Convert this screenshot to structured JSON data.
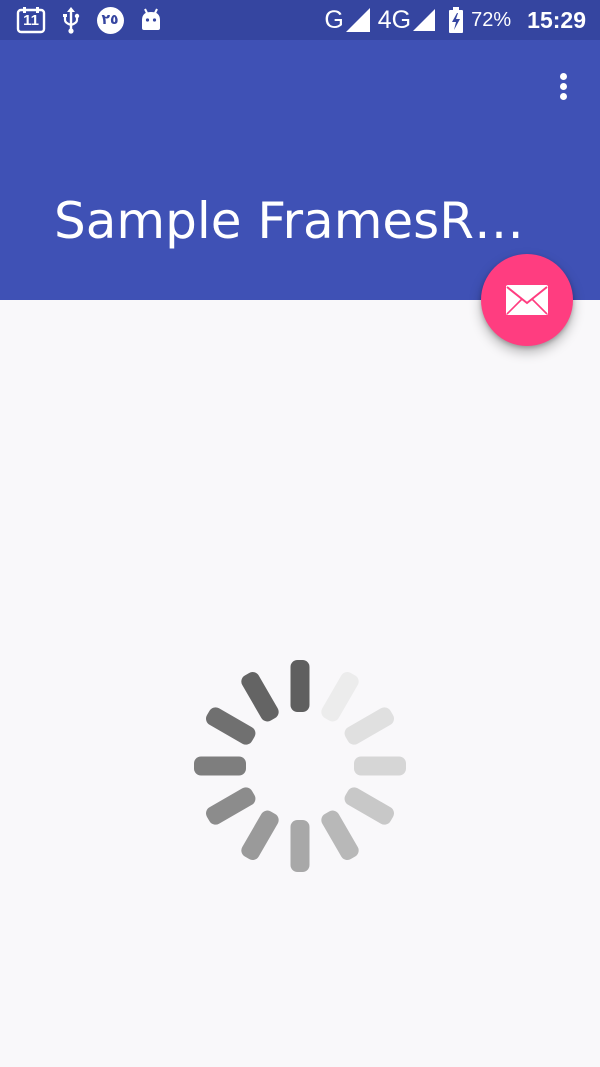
{
  "status_bar": {
    "icons": [
      "calendar-icon",
      "usb-icon",
      "notification-badge-icon",
      "android-icon",
      "signal-icon",
      "battery-charging-icon"
    ],
    "calendar_day": "11",
    "badge_text": "٢٥",
    "network_g": "G",
    "network_4g": "4G",
    "battery_percent": "72%",
    "time": "15:29"
  },
  "app_bar": {
    "title": "Sample FramesR…",
    "overflow_icon": "more-vert-icon"
  },
  "fab": {
    "icon": "email-icon",
    "color": "#ff3d80"
  },
  "colors": {
    "primary": "#3f51b5",
    "primary_dark": "#3545a0",
    "accent": "#ff3d80",
    "background": "#f9f8fa"
  },
  "spinner": {
    "icon": "loading-spinner-icon",
    "spokes": 12
  }
}
